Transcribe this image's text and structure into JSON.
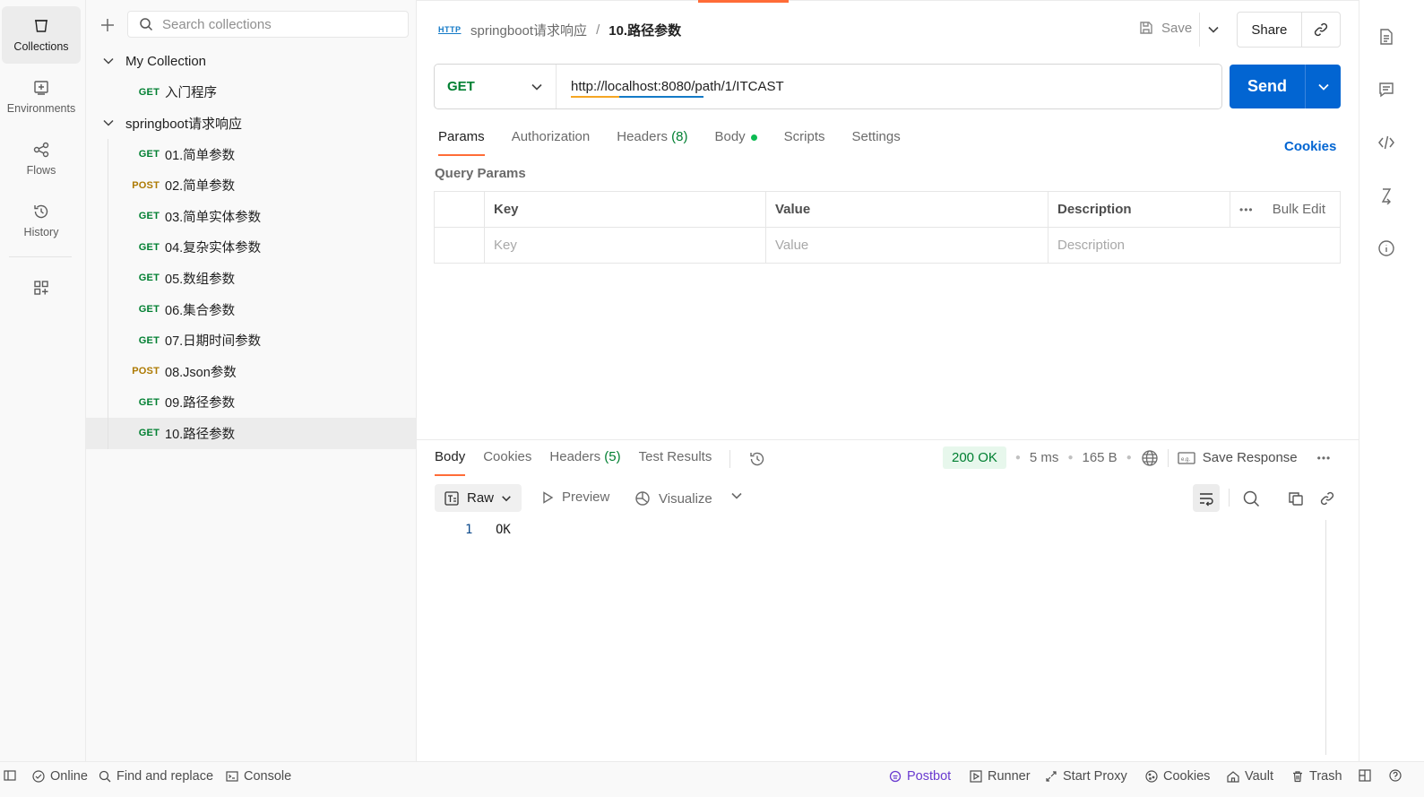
{
  "rail": {
    "items": [
      {
        "label": "Collections"
      },
      {
        "label": "Environments"
      },
      {
        "label": "Flows"
      },
      {
        "label": "History"
      }
    ]
  },
  "sidebar": {
    "search_placeholder": "Search collections",
    "collections": [
      {
        "name": "My Collection",
        "requests": [
          {
            "method": "GET",
            "name": "入门程序"
          }
        ]
      },
      {
        "name": "springboot请求响应",
        "requests": [
          {
            "method": "GET",
            "name": "01.简单参数"
          },
          {
            "method": "POST",
            "name": "02.简单参数"
          },
          {
            "method": "GET",
            "name": "03.简单实体参数"
          },
          {
            "method": "GET",
            "name": "04.复杂实体参数"
          },
          {
            "method": "GET",
            "name": "05.数组参数"
          },
          {
            "method": "GET",
            "name": "06.集合参数"
          },
          {
            "method": "GET",
            "name": "07.日期时间参数"
          },
          {
            "method": "POST",
            "name": "08.Json参数"
          },
          {
            "method": "GET",
            "name": "09.路径参数"
          },
          {
            "method": "GET",
            "name": "10.路径参数"
          }
        ]
      }
    ]
  },
  "header": {
    "http_badge": "HTTP",
    "breadcrumb_parent": "springboot请求响应",
    "breadcrumb_sep": "/",
    "breadcrumb_current": "10.路径参数",
    "save_label": "Save",
    "share_label": "Share"
  },
  "request": {
    "method": "GET",
    "url": "http://localhost:8080/path/1/ITCAST",
    "send_label": "Send",
    "tabs": {
      "params": "Params",
      "authorization": "Authorization",
      "headers": "Headers",
      "headers_count": "(8)",
      "body": "Body",
      "scripts": "Scripts",
      "settings": "Settings"
    },
    "cookies_link": "Cookies",
    "query_params_label": "Query Params",
    "table": {
      "col_key": "Key",
      "col_value": "Value",
      "col_description": "Description",
      "bulk_edit": "Bulk Edit",
      "placeholder_key": "Key",
      "placeholder_value": "Value",
      "placeholder_description": "Description"
    }
  },
  "response": {
    "tabs": {
      "body": "Body",
      "cookies": "Cookies",
      "headers": "Headers",
      "headers_count": "(5)",
      "test_results": "Test Results"
    },
    "status": "200 OK",
    "time": "5 ms",
    "size": "165 B",
    "save_response": "Save Response",
    "view_mode": "Raw",
    "preview": "Preview",
    "visualize": "Visualize",
    "line_number": "1",
    "body_text": "OK"
  },
  "statusbar": {
    "online": "Online",
    "find_replace": "Find and replace",
    "console": "Console",
    "postbot": "Postbot",
    "runner": "Runner",
    "start_proxy": "Start Proxy",
    "cookies": "Cookies",
    "vault": "Vault",
    "trash": "Trash"
  },
  "colors": {
    "accent": "#ff6c37",
    "send": "#0265d2",
    "get": "#007f31",
    "post": "#ad7a03"
  }
}
